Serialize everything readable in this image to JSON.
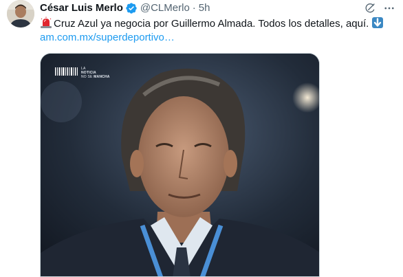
{
  "tweet": {
    "author_name": "César Luis Merlo",
    "handle": "@CLMerlo",
    "separator": "·",
    "time": "5h",
    "text_body": "Cruz Azul ya negocia por Guillermo Almada. Todos los detalles, aquí.",
    "link": "am.com.mx/superdeportivo…",
    "leading_emoji_icon": "police-light-icon",
    "trailing_emoji_icon": "down-arrow-icon"
  },
  "media": {
    "watermark_line1": "La",
    "watermark_line2": "Noticia",
    "watermark_line3": "no se",
    "watermark_line4": "mancha"
  },
  "colors": {
    "text": "#0f1419",
    "secondary": "#536471",
    "link": "#1d9bf0",
    "verified": "#1d9bf0"
  },
  "icons": {
    "verified": "verified-badge-icon",
    "grok": "grok-icon",
    "more": "more-options-icon"
  }
}
